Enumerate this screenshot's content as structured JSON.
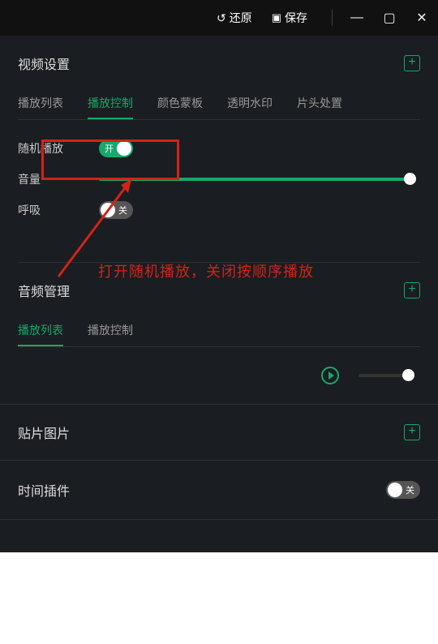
{
  "titlebar": {
    "restore": "还原",
    "save": "保存"
  },
  "sections": {
    "video": {
      "title": "视频设置",
      "tabs": [
        "播放列表",
        "播放控制",
        "颜色蒙板",
        "透明水印",
        "片头处置"
      ],
      "activeIndex": 1
    },
    "audio": {
      "title": "音频管理",
      "tabs": [
        "播放列表",
        "播放控制"
      ],
      "activeIndex": 0
    },
    "sticker": {
      "title": "贴片图片"
    },
    "time": {
      "title": "时间插件"
    }
  },
  "playback": {
    "shuffle": {
      "label": "随机播放",
      "state": "开"
    },
    "volume": {
      "label": "音量"
    },
    "breath": {
      "label": "呼吸",
      "state": "关"
    }
  },
  "timeToggle": {
    "state": "关"
  },
  "annotation": "打开随机播放，关闭按顺序播放"
}
